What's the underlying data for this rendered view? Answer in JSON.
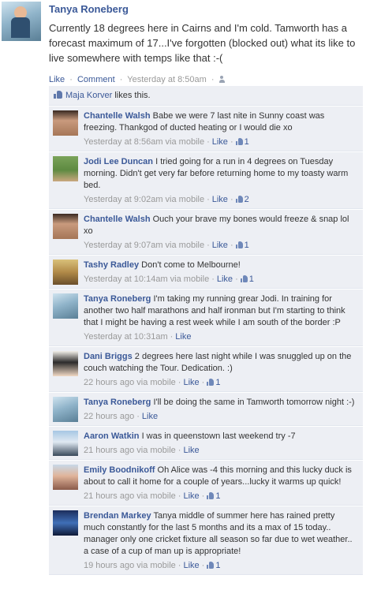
{
  "post": {
    "author": "Tanya Roneberg",
    "message": "Currently 18 degrees here in Cairns and I'm cold. Tamworth has a forecast maximum of 17...I've forgotten (blocked out) what its like to live somewhere with temps like that :-(",
    "like_label": "Like",
    "comment_label": "Comment",
    "timestamp": "Yesterday at 8:50am"
  },
  "likes": {
    "name": "Maja Korver",
    "suffix": " likes this."
  },
  "comments": [
    {
      "name": "Chantelle Walsh",
      "text": "Babe we were 7 last nite in Sunny coast was freezing. Thankgod of ducted heating or I would die xo",
      "time": "Yesterday at 8:56am via mobile",
      "like": "Like",
      "count": "1",
      "avatar": "av-chantelle"
    },
    {
      "name": "Jodi Lee Duncan",
      "text": "I tried going for a run in 4 degrees on Tuesday morning. Didn't get very far before returning home to my toasty warm bed.",
      "time": "Yesterday at 9:02am via mobile",
      "like": "Like",
      "count": "2",
      "avatar": "av-jodi"
    },
    {
      "name": "Chantelle Walsh",
      "text": "Ouch your brave my bones would freeze & snap lol xo",
      "time": "Yesterday at 9:07am via mobile",
      "like": "Like",
      "count": "1",
      "avatar": "av-chantelle"
    },
    {
      "name": "Tashy Radley",
      "text": "Don't come to Melbourne!",
      "time": "Yesterday at 10:14am via mobile",
      "like": "Like",
      "count": "1",
      "avatar": "av-tashy"
    },
    {
      "name": "Tanya Roneberg",
      "text": "I'm taking my running grear Jodi. In training for another two half marathons and half ironman but I'm starting to think that I might be having a rest week while I am south of the border :P",
      "time": "Yesterday at 10:31am",
      "like": "Like",
      "count": "",
      "avatar": "av-tanya"
    },
    {
      "name": "Dani Briggs",
      "text": "2 degrees here last night while I was snuggled up on the couch watching the Tour. Dedication. :)",
      "time": "22 hours ago via mobile",
      "like": "Like",
      "count": "1",
      "avatar": "av-dani"
    },
    {
      "name": "Tanya Roneberg",
      "text": "I'll be doing the same in Tamworth tomorrow night :-)",
      "time": "22 hours ago",
      "like": "Like",
      "count": "",
      "avatar": "av-tanya"
    },
    {
      "name": "Aaron Watkin",
      "text": "I was in queenstown last weekend try -7",
      "time": "21 hours ago via mobile",
      "like": "Like",
      "count": "",
      "avatar": "av-aaron"
    },
    {
      "name": "Emily Boodnikoff",
      "text": "Oh Alice was -4 this morning and this lucky duck is about to call it home for a couple of years...lucky it warms up quick!",
      "time": "21 hours ago via mobile",
      "like": "Like",
      "count": "1",
      "avatar": "av-emily"
    },
    {
      "name": "Brendan Markey",
      "text": "Tanya middle of summer here has rained pretty much constantly for the last 5 months and its a max of 15 today.. manager only one cricket fixture all season so far due to wet weather.. a case of a cup of man up is appropriate!",
      "time": "19 hours ago via mobile",
      "like": "Like",
      "count": "1",
      "avatar": "av-brendan"
    }
  ]
}
